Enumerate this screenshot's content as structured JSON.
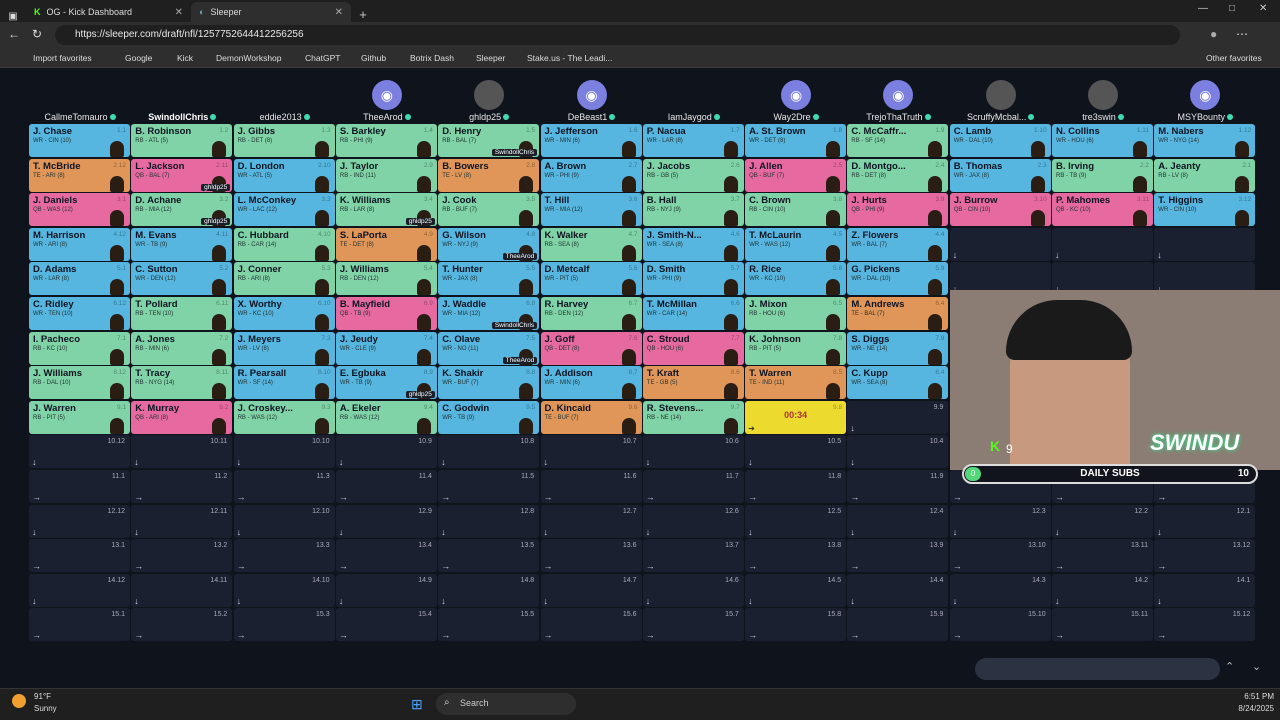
{
  "browser": {
    "tabs": [
      {
        "label": "OG - Kick Dashboard"
      },
      {
        "label": "Sleeper"
      }
    ],
    "url": "https://sleeper.com/draft/nfl/1257752644412256256",
    "favorites": [
      "Import favorites",
      "Google",
      "Kick",
      "DemonWorkshop",
      "ChatGPT",
      "Github",
      "Botrix Dash",
      "Sleeper",
      "Stake.us - The Leadi..."
    ],
    "other_favorites": "Other favorites"
  },
  "teams": [
    {
      "name": "CallmeTomauro",
      "hl": false,
      "av": ""
    },
    {
      "name": "SwindollChris",
      "hl": true,
      "av": ""
    },
    {
      "name": "eddie2013",
      "hl": false,
      "av": ""
    },
    {
      "name": "TheeArod",
      "hl": false,
      "av": "robot"
    },
    {
      "name": "ghldp25",
      "hl": false,
      "av": "photo"
    },
    {
      "name": "DeBeast1",
      "hl": false,
      "av": "robot"
    },
    {
      "name": "IamJaygod",
      "hl": false,
      "av": ""
    },
    {
      "name": "Way2Dre",
      "hl": false,
      "av": "robot"
    },
    {
      "name": "TrejoThaTruth",
      "hl": false,
      "av": "robot"
    },
    {
      "name": "ScruffyMcbal...",
      "hl": false,
      "av": "photo"
    },
    {
      "name": "tre3swin",
      "hl": false,
      "av": "photo"
    },
    {
      "name": "MSYBounty",
      "hl": false,
      "av": "robot"
    }
  ],
  "rows": [
    [
      [
        "J. Chase",
        "WR - CIN (10)",
        "1.1",
        "WR"
      ],
      [
        "B. Robinson",
        "RB - ATL (5)",
        "1.2",
        "RB"
      ],
      [
        "J. Gibbs",
        "RB - DET (8)",
        "1.3",
        "RB"
      ],
      [
        "S. Barkley",
        "RB - PHI (9)",
        "1.4",
        "RB"
      ],
      [
        "D. Henry",
        "RB - BAL (7)",
        "1.5",
        "RB",
        "SwindollChris"
      ],
      [
        "J. Jefferson",
        "WR - MIN (6)",
        "1.6",
        "WR"
      ],
      [
        "P. Nacua",
        "WR - LAR (8)",
        "1.7",
        "WR"
      ],
      [
        "A. St. Brown",
        "WR - DET (8)",
        "1.8",
        "WR"
      ],
      [
        "C. McCaffr...",
        "RB - SF (14)",
        "1.9",
        "RB"
      ],
      [
        "C. Lamb",
        "WR - DAL (10)",
        "1.10",
        "WR"
      ],
      [
        "N. Collins",
        "WR - HOU (6)",
        "1.11",
        "WR"
      ],
      [
        "M. Nabers",
        "WR - NYG (14)",
        "1.12",
        "WR"
      ]
    ],
    [
      [
        "T. McBride",
        "TE - ARI (8)",
        "2.12",
        "TE"
      ],
      [
        "L. Jackson",
        "QB - BAL (7)",
        "2.11",
        "QB",
        "ghldp25"
      ],
      [
        "D. London",
        "WR - ATL (5)",
        "2.10",
        "WR"
      ],
      [
        "J. Taylor",
        "RB - IND (11)",
        "2.9",
        "RB"
      ],
      [
        "B. Bowers",
        "TE - LV (8)",
        "2.8",
        "TE"
      ],
      [
        "A. Brown",
        "WR - PHI (9)",
        "2.7",
        "WR"
      ],
      [
        "J. Jacobs",
        "RB - GB (5)",
        "2.6",
        "RB"
      ],
      [
        "J. Allen",
        "QB - BUF (7)",
        "2.5",
        "QB"
      ],
      [
        "D. Montgo...",
        "RB - DET (8)",
        "2.4",
        "RB"
      ],
      [
        "B. Thomas",
        "WR - JAX (8)",
        "2.3",
        "WR"
      ],
      [
        "B. Irving",
        "RB - TB (9)",
        "2.2",
        "RB"
      ],
      [
        "A. Jeanty",
        "RB - LV (8)",
        "2.1",
        "RB"
      ]
    ],
    [
      [
        "J. Daniels",
        "QB - WAS (12)",
        "3.1",
        "QB"
      ],
      [
        "D. Achane",
        "RB - MIA (12)",
        "3.2",
        "RB",
        "ghldp25"
      ],
      [
        "L. McConkey",
        "WR - LAC (12)",
        "3.3",
        "WR"
      ],
      [
        "K. Williams",
        "RB - LAR (8)",
        "3.4",
        "RB",
        "ghldp25"
      ],
      [
        "J. Cook",
        "RB - BUF (7)",
        "3.5",
        "RB"
      ],
      [
        "T. Hill",
        "WR - MIA (12)",
        "3.6",
        "WR"
      ],
      [
        "B. Hall",
        "RB - NYJ (9)",
        "3.7",
        "RB"
      ],
      [
        "C. Brown",
        "RB - CIN (10)",
        "3.8",
        "RB"
      ],
      [
        "J. Hurts",
        "QB - PHI (9)",
        "3.9",
        "QB"
      ],
      [
        "J. Burrow",
        "QB - CIN (10)",
        "3.10",
        "QB"
      ],
      [
        "P. Mahomes",
        "QB - KC (10)",
        "3.11",
        "QB"
      ],
      [
        "T. Higgins",
        "WR - CIN (10)",
        "3.12",
        "WR"
      ]
    ],
    [
      [
        "M. Harrison",
        "WR - ARI (8)",
        "4.12",
        "WR"
      ],
      [
        "M. Evans",
        "WR - TB (9)",
        "4.11",
        "WR"
      ],
      [
        "C. Hubbard",
        "RB - CAR (14)",
        "4.10",
        "RB"
      ],
      [
        "S. LaPorta",
        "TE - DET (8)",
        "4.9",
        "TE"
      ],
      [
        "G. Wilson",
        "WR - NYJ (9)",
        "4.8",
        "WR",
        "TheeArod"
      ],
      [
        "K. Walker",
        "RB - SEA (8)",
        "4.7",
        "RB"
      ],
      [
        "J. Smith-N...",
        "WR - SEA (8)",
        "4.6",
        "WR"
      ],
      [
        "T. McLaurin",
        "WR - WAS (12)",
        "4.5",
        "WR"
      ],
      [
        "Z. Flowers",
        "WR - BAL (7)",
        "4.4",
        "WR"
      ],
      [
        "",
        "",
        "",
        "EMPTY"
      ],
      [
        "",
        "",
        "",
        "EMPTY"
      ],
      [
        "",
        "",
        "",
        "EMPTY"
      ]
    ],
    [
      [
        "D. Adams",
        "WR - LAR (8)",
        "5.1",
        "WR"
      ],
      [
        "C. Sutton",
        "WR - DEN (12)",
        "5.2",
        "WR"
      ],
      [
        "J. Conner",
        "RB - ARI (8)",
        "5.3",
        "RB"
      ],
      [
        "J. Williams",
        "RB - DEN (12)",
        "5.4",
        "RB"
      ],
      [
        "T. Hunter",
        "WR - JAX (8)",
        "5.5",
        "WR"
      ],
      [
        "D. Metcalf",
        "WR - PIT (5)",
        "5.6",
        "WR"
      ],
      [
        "D. Smith",
        "WR - PHI (9)",
        "5.7",
        "WR"
      ],
      [
        "R. Rice",
        "WR - KC (10)",
        "5.8",
        "WR"
      ],
      [
        "G. Pickens",
        "WR - DAL (10)",
        "5.9",
        "WR"
      ],
      [
        "",
        "",
        "",
        "EMPTY"
      ],
      [
        "",
        "",
        "",
        "EMPTY"
      ],
      [
        "",
        "",
        "",
        "EMPTY"
      ]
    ],
    [
      [
        "C. Ridley",
        "WR - TEN (10)",
        "6.12",
        "WR"
      ],
      [
        "T. Pollard",
        "RB - TEN (10)",
        "6.11",
        "RB"
      ],
      [
        "X. Worthy",
        "WR - KC (10)",
        "6.10",
        "WR"
      ],
      [
        "B. Mayfield",
        "QB - TB (9)",
        "6.9",
        "QB"
      ],
      [
        "J. Waddle",
        "WR - MIA (12)",
        "6.8",
        "WR",
        "SwindollChris"
      ],
      [
        "R. Harvey",
        "RB - DEN (12)",
        "6.7",
        "RB"
      ],
      [
        "T. McMillan",
        "WR - CAR (14)",
        "6.6",
        "WR"
      ],
      [
        "J. Mixon",
        "RB - HOU (6)",
        "6.5",
        "RB"
      ],
      [
        "M. Andrews",
        "TE - BAL (7)",
        "6.4",
        "TE"
      ],
      [
        "",
        "",
        "",
        "EMPTY"
      ],
      [
        "",
        "",
        "",
        "EMPTY"
      ],
      [
        "",
        "",
        "",
        "EMPTY"
      ]
    ],
    [
      [
        "I. Pacheco",
        "RB - KC (10)",
        "7.1",
        "RB"
      ],
      [
        "A. Jones",
        "RB - MIN (6)",
        "7.2",
        "RB"
      ],
      [
        "J. Meyers",
        "WR - LV (8)",
        "7.3",
        "WR"
      ],
      [
        "J. Jeudy",
        "WR - CLE (9)",
        "7.4",
        "WR"
      ],
      [
        "C. Olave",
        "WR - NO (11)",
        "7.5",
        "WR",
        "TheeArod"
      ],
      [
        "J. Goff",
        "QB - DET (8)",
        "7.6",
        "QB"
      ],
      [
        "C. Stroud",
        "QB - HOU (6)",
        "7.7",
        "QB"
      ],
      [
        "K. Johnson",
        "RB - PIT (5)",
        "7.8",
        "RB"
      ],
      [
        "S. Diggs",
        "WR - NE (14)",
        "7.9",
        "WR"
      ],
      [
        "",
        "",
        "",
        "EMPTY"
      ],
      [
        "",
        "",
        "",
        "EMPTY"
      ],
      [
        "",
        "",
        "",
        "EMPTY"
      ]
    ],
    [
      [
        "J. Williams",
        "RB - DAL (10)",
        "8.12",
        "RB"
      ],
      [
        "T. Tracy",
        "RB - NYG (14)",
        "8.11",
        "RB"
      ],
      [
        "R. Pearsall",
        "WR - SF (14)",
        "8.10",
        "WR"
      ],
      [
        "E. Egbuka",
        "WR - TB (9)",
        "8.9",
        "WR",
        "ghldp25"
      ],
      [
        "K. Shakir",
        "WR - BUF (7)",
        "8.8",
        "WR"
      ],
      [
        "J. Addison",
        "WR - MIN (6)",
        "8.7",
        "WR"
      ],
      [
        "T. Kraft",
        "TE - GB (5)",
        "8.6",
        "TE"
      ],
      [
        "T. Warren",
        "TE - IND (11)",
        "8.5",
        "TE"
      ],
      [
        "C. Kupp",
        "WR - SEA (8)",
        "8.4",
        "WR"
      ],
      [
        "",
        "",
        "",
        "EMPTY"
      ],
      [
        "",
        "",
        "",
        "EMPTY"
      ],
      [
        "",
        "",
        "",
        "EMPTY"
      ]
    ],
    [
      [
        "J. Warren",
        "RB - PIT (5)",
        "9.1",
        "RB"
      ],
      [
        "K. Murray",
        "QB - ARI (8)",
        "9.2",
        "QB"
      ],
      [
        "J. Croskey...",
        "RB - WAS (12)",
        "9.3",
        "RB"
      ],
      [
        "A. Ekeler",
        "RB - WAS (12)",
        "9.4",
        "RB"
      ],
      [
        "C. Godwin",
        "WR - TB (9)",
        "9.5",
        "WR"
      ],
      [
        "D. Kincaid",
        "TE - BUF (7)",
        "9.6",
        "TE"
      ],
      [
        "R. Stevens...",
        "RB - NE (14)",
        "9.7",
        "RB"
      ],
      [
        "",
        "00:34",
        "9.8",
        "TIMER"
      ],
      [
        "",
        "",
        "9.9",
        "EMPTY"
      ],
      [
        "",
        "",
        "9.10",
        "EMPTY"
      ],
      [
        "",
        "",
        "9.11",
        "EMPTY"
      ],
      [
        "",
        "",
        "9.12",
        "EMPTY"
      ]
    ]
  ],
  "empty_rows": [
    [
      "10.12",
      "10.11",
      "10.10",
      "10.9",
      "10.8",
      "10.7",
      "10.6",
      "10.5",
      "10.4",
      "10.3",
      "10.2",
      "10.1"
    ],
    [
      "11.1",
      "11.2",
      "11.3",
      "11.4",
      "11.5",
      "11.6",
      "11.7",
      "11.8",
      "11.9",
      "11.10",
      "11.11",
      "11.12"
    ],
    [
      "12.12",
      "12.11",
      "12.10",
      "12.9",
      "12.8",
      "12.7",
      "12.6",
      "12.5",
      "12.4",
      "12.3",
      "12.2",
      "12.1"
    ],
    [
      "13.1",
      "13.2",
      "13.3",
      "13.4",
      "13.5",
      "13.6",
      "13.7",
      "13.8",
      "13.9",
      "13.10",
      "13.11",
      "13.12"
    ],
    [
      "14.12",
      "14.11",
      "14.10",
      "14.9",
      "14.8",
      "14.7",
      "14.6",
      "14.5",
      "14.4",
      "14.3",
      "14.2",
      "14.1"
    ],
    [
      "15.1",
      "15.2",
      "15.3",
      "15.4",
      "15.5",
      "15.6",
      "15.7",
      "15.8",
      "15.9",
      "15.10",
      "15.11",
      "15.12"
    ]
  ],
  "overlay": {
    "brand": "SWINDU",
    "kick_count": "9",
    "subs_label": "DAILY SUBS",
    "subs_current": "0",
    "subs_goal": "10"
  },
  "taskbar": {
    "temp": "91°F",
    "weather": "Sunny",
    "search": "Search",
    "time": "6:51 PM",
    "date": "8/24/2025"
  }
}
